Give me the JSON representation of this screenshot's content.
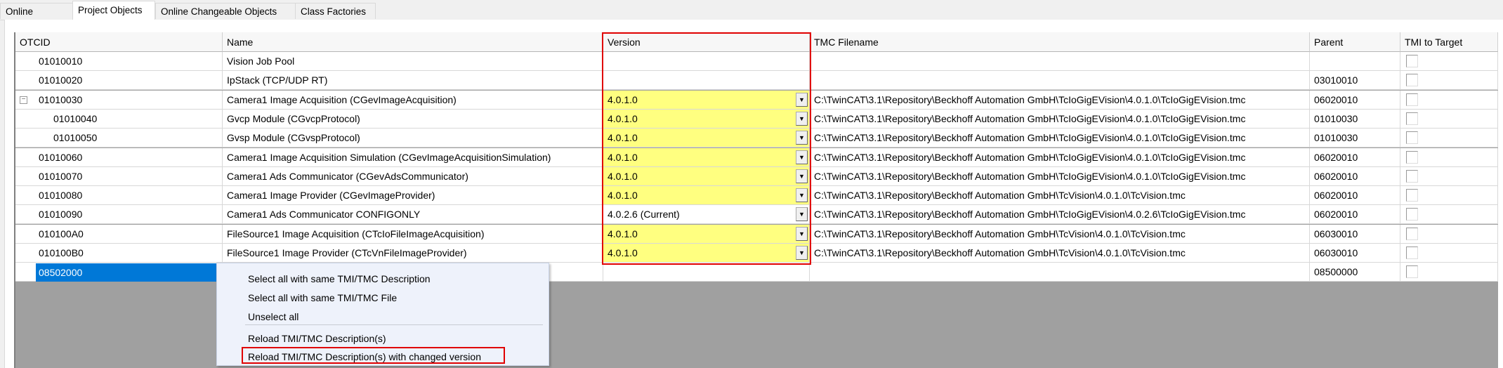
{
  "tabs": [
    {
      "label": "Online Objects",
      "active": false
    },
    {
      "label": "Project Objects",
      "active": true
    },
    {
      "label": "Online Changeable Objects",
      "active": false
    },
    {
      "label": "Class Factories",
      "active": false
    }
  ],
  "columns": [
    "OTCID",
    "Name",
    "Version",
    "TMC Filename",
    "Parent",
    "TMI to Target"
  ],
  "rows": [
    {
      "otcid": "01010010",
      "name": "Vision Job Pool",
      "version": "",
      "changed": false,
      "tmc": "",
      "parent": "",
      "tmi": false,
      "level": 0
    },
    {
      "otcid": "01010020",
      "name": "IpStack (TCP/UDP RT)",
      "version": "",
      "changed": false,
      "tmc": "",
      "parent": "03010010",
      "tmi": false,
      "level": 0
    },
    {
      "otcid": "01010030",
      "name": "Camera1 Image Acquisition (CGevImageAcquisition)",
      "version": "4.0.1.0",
      "changed": true,
      "tmc": "C:\\TwinCAT\\3.1\\Repository\\Beckhoff Automation GmbH\\TcIoGigEVision\\4.0.1.0\\TcIoGigEVision.tmc",
      "parent": "06020010",
      "tmi": false,
      "level": 0,
      "expanded": true
    },
    {
      "otcid": "01010040",
      "name": "Gvcp Module (CGvcpProtocol)",
      "version": "4.0.1.0",
      "changed": true,
      "tmc": "C:\\TwinCAT\\3.1\\Repository\\Beckhoff Automation GmbH\\TcIoGigEVision\\4.0.1.0\\TcIoGigEVision.tmc",
      "parent": "01010030",
      "tmi": false,
      "level": 1
    },
    {
      "otcid": "01010050",
      "name": "Gvsp Module (CGvspProtocol)",
      "version": "4.0.1.0",
      "changed": true,
      "tmc": "C:\\TwinCAT\\3.1\\Repository\\Beckhoff Automation GmbH\\TcIoGigEVision\\4.0.1.0\\TcIoGigEVision.tmc",
      "parent": "01010030",
      "tmi": false,
      "level": 1
    },
    {
      "otcid": "01010060",
      "name": "Camera1 Image Acquisition Simulation (CGevImageAcquisitionSimulation)",
      "version": "4.0.1.0",
      "changed": true,
      "tmc": "C:\\TwinCAT\\3.1\\Repository\\Beckhoff Automation GmbH\\TcIoGigEVision\\4.0.1.0\\TcIoGigEVision.tmc",
      "parent": "06020010",
      "tmi": false,
      "level": 0
    },
    {
      "otcid": "01010070",
      "name": "Camera1 Ads Communicator (CGevAdsCommunicator)",
      "version": "4.0.1.0",
      "changed": true,
      "tmc": "C:\\TwinCAT\\3.1\\Repository\\Beckhoff Automation GmbH\\TcIoGigEVision\\4.0.1.0\\TcIoGigEVision.tmc",
      "parent": "06020010",
      "tmi": false,
      "level": 0
    },
    {
      "otcid": "01010080",
      "name": "Camera1 Image Provider (CGevImageProvider)",
      "version": "4.0.1.0",
      "changed": true,
      "tmc": "C:\\TwinCAT\\3.1\\Repository\\Beckhoff Automation GmbH\\TcVision\\4.0.1.0\\TcVision.tmc",
      "parent": "06020010",
      "tmi": false,
      "level": 0
    },
    {
      "otcid": "01010090",
      "name": "Camera1 Ads Communicator CONFIGONLY",
      "version": "4.0.2.6 (Current)",
      "changed": false,
      "tmc": "C:\\TwinCAT\\3.1\\Repository\\Beckhoff Automation GmbH\\TcIoGigEVision\\4.0.2.6\\TcIoGigEVision.tmc",
      "parent": "06020010",
      "tmi": false,
      "level": 0
    },
    {
      "otcid": "010100A0",
      "name": "FileSource1 Image Acquisition (CTcIoFileImageAcquisition)",
      "version": "4.0.1.0",
      "changed": true,
      "tmc": "C:\\TwinCAT\\3.1\\Repository\\Beckhoff Automation GmbH\\TcVision\\4.0.1.0\\TcVision.tmc",
      "parent": "06030010",
      "tmi": false,
      "level": 0
    },
    {
      "otcid": "010100B0",
      "name": "FileSource1 Image Provider (CTcVnFileImageProvider)",
      "version": "4.0.1.0",
      "changed": true,
      "tmc": "C:\\TwinCAT\\3.1\\Repository\\Beckhoff Automation GmbH\\TcVision\\4.0.1.0\\TcVision.tmc",
      "parent": "06030010",
      "tmi": false,
      "level": 0
    },
    {
      "otcid": "08502000",
      "name": "",
      "version": "",
      "changed": false,
      "tmc": "",
      "parent": "08500000",
      "tmi": false,
      "level": 0,
      "selected": true
    }
  ],
  "context_menu": {
    "items": [
      "Select all with same TMI/TMC Description",
      "Select all with same TMI/TMC File",
      "Unselect all",
      "Reload TMI/TMC Description(s)",
      "Reload TMI/TMC Description(s) with changed version"
    ],
    "highlighted_item": "Reload TMI/TMC Description(s) with changed version"
  },
  "colors": {
    "changed_version": "#ffff80",
    "selection": "#0078d7",
    "annotation_red": "#e00000"
  }
}
